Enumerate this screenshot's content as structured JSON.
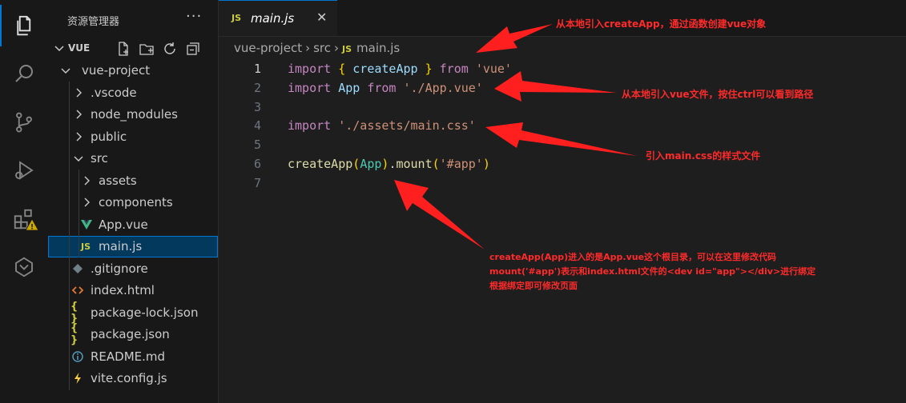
{
  "sidebar": {
    "title": "资源管理器",
    "more": "···",
    "section": "VUE",
    "tree": [
      {
        "label": "vue-project",
        "type": "folder-open",
        "depth": 0
      },
      {
        "label": ".vscode",
        "type": "folder",
        "depth": 1
      },
      {
        "label": "node_modules",
        "type": "folder",
        "depth": 1
      },
      {
        "label": "public",
        "type": "folder",
        "depth": 1
      },
      {
        "label": "src",
        "type": "folder-open",
        "depth": 1
      },
      {
        "label": "assets",
        "type": "folder",
        "depth": 2
      },
      {
        "label": "components",
        "type": "folder",
        "depth": 2
      },
      {
        "label": "App.vue",
        "type": "vue-file",
        "depth": 2
      },
      {
        "label": "main.js",
        "type": "js-file",
        "depth": 2,
        "selected": true
      },
      {
        "label": ".gitignore",
        "type": "git-file",
        "depth": 1
      },
      {
        "label": "index.html",
        "type": "html-file",
        "depth": 1
      },
      {
        "label": "package-lock.json",
        "type": "json-file",
        "depth": 1
      },
      {
        "label": "package.json",
        "type": "json-file",
        "depth": 1
      },
      {
        "label": "README.md",
        "type": "info-file",
        "depth": 1
      },
      {
        "label": "vite.config.js",
        "type": "vite-file",
        "depth": 1
      }
    ]
  },
  "editor": {
    "tab": {
      "js_badge": "JS",
      "name": "main.js",
      "close": "✕"
    },
    "breadcrumb": {
      "folder1": "vue-project",
      "folder2": "src",
      "js_badge": "JS",
      "file": "main.js"
    },
    "line_numbers": [
      "1",
      "2",
      "3",
      "4",
      "5",
      "6",
      "7"
    ],
    "code": {
      "l1": {
        "kw1": "import",
        "b1": "{",
        "id": "createApp",
        "b2": "}",
        "kw2": "from",
        "str": "'vue'"
      },
      "l2": {
        "kw1": "import",
        "id": "App",
        "kw2": "from",
        "str": "'./App.vue'"
      },
      "l4": {
        "kw1": "import",
        "str": "'./assets/main.css'"
      },
      "l6": {
        "fn": "createApp",
        "p1": "(",
        "arg": "App",
        "p2": ")",
        "dot": ".",
        "fn2": "mount",
        "p3": "(",
        "str": "'#app'",
        "p4": ")"
      }
    }
  },
  "annotations": {
    "note1": "从本地引入createApp，通过函数创建vue对象",
    "note2": "从本地引入vue文件，按住ctrl可以看到路径",
    "note3": "引入main.css的样式文件",
    "note4": [
      "createApp(App)进入的是App.vue这个根目录，可以在这里修改代码",
      "mount('#app')表示和index.html文件的<dev id=\"app\"></div>进行绑定",
      "根据绑定即可修改页面"
    ]
  },
  "colors": {
    "accent": "#0078d4",
    "annotation": "#ff2a2a",
    "js_badge": "#cbcb41",
    "vue_logo": "#41b883"
  },
  "icons": [
    "explorer-icon",
    "search-icon",
    "source-control-icon",
    "run-debug-icon",
    "extensions-icon",
    "warning-icon",
    "remote-icon"
  ]
}
